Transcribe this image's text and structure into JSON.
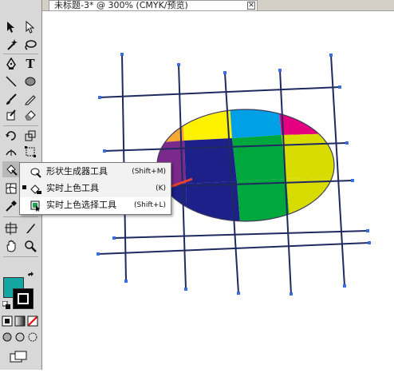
{
  "document_tab": {
    "title": "未标题-3* @ 300% (CMYK/预览)",
    "close_glyph": "✕"
  },
  "toolbar": {
    "tools": [
      {
        "name": "selection-tool-icon"
      },
      {
        "name": "direct-selection-tool-icon"
      },
      {
        "name": "magic-wand-tool-icon"
      },
      {
        "name": "lasso-tool-icon"
      },
      {
        "name": "pen-tool-icon"
      },
      {
        "name": "type-tool-icon",
        "glyph": "T"
      },
      {
        "name": "line-segment-tool-icon"
      },
      {
        "name": "ellipse-tool-icon"
      },
      {
        "name": "paintbrush-tool-icon"
      },
      {
        "name": "pencil-tool-icon"
      },
      {
        "name": "blob-brush-tool-icon"
      },
      {
        "name": "eraser-tool-icon"
      },
      {
        "name": "rotate-tool-icon"
      },
      {
        "name": "scale-tool-icon"
      },
      {
        "name": "width-tool-icon"
      },
      {
        "name": "free-transform-tool-icon"
      },
      {
        "name": "shape-builder-tool-icon"
      },
      {
        "name": "mesh-tool-icon"
      },
      {
        "name": "gradient-tool-icon"
      },
      {
        "name": "eyedropper-tool-icon"
      },
      {
        "name": "artboard-tool-icon"
      },
      {
        "name": "slice-tool-icon"
      },
      {
        "name": "hand-tool-icon"
      },
      {
        "name": "zoom-tool-icon"
      }
    ],
    "fill_color": "#14a6a0",
    "stroke_color": "#000000"
  },
  "flyout_menu": {
    "items": [
      {
        "label": "形状生成器工具",
        "shortcut": "(Shift+M)",
        "icon": "shape-builder-icon",
        "checked": false
      },
      {
        "label": "实时上色工具",
        "shortcut": "(K)",
        "icon": "live-paint-bucket-icon",
        "checked": true
      },
      {
        "label": "实时上色选择工具",
        "shortcut": "(Shift+L)",
        "icon": "live-paint-selection-icon",
        "checked": false
      }
    ]
  },
  "artwork": {
    "cell_colors": {
      "green": "#12a96a",
      "red": "#e53425",
      "yellow": "#fff200",
      "orange": "#f7a833",
      "cyan": "#00a0e6",
      "magenta": "#e4007f",
      "navy": "#1d2088",
      "bright_green": "#00a73c",
      "olive_yellow": "#d8dc00",
      "purple": "#7b2a8c"
    },
    "grid_color": "#1f2a60",
    "annotation_arrow_color": "#e8412b"
  }
}
